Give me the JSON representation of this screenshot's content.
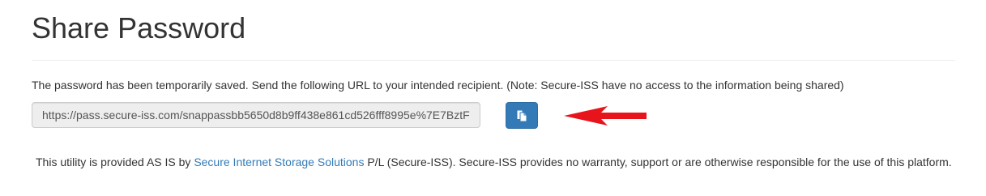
{
  "page": {
    "title": "Share Password"
  },
  "message": {
    "text": "The password has been temporarily saved. Send the following URL to your intended recipient. (Note: Secure-ISS have no access to the information being shared)"
  },
  "share": {
    "url_value": "https://pass.secure-iss.com/snappassbb5650d8b9ff438e861cd526fff8995e%7E7BztF",
    "copy_button_icon": "copy-icon",
    "annotation_arrow_color": "#e8141c"
  },
  "footer": {
    "text_before": "This utility is provided AS IS by ",
    "link_text": "Secure Internet Storage Solutions",
    "text_after": " P/L (Secure-ISS). Secure-ISS provides no warranty, support or are otherwise responsible for the use of this platform."
  },
  "colors": {
    "primary": "#337ab7",
    "text": "#333333",
    "link": "#337ab7"
  }
}
